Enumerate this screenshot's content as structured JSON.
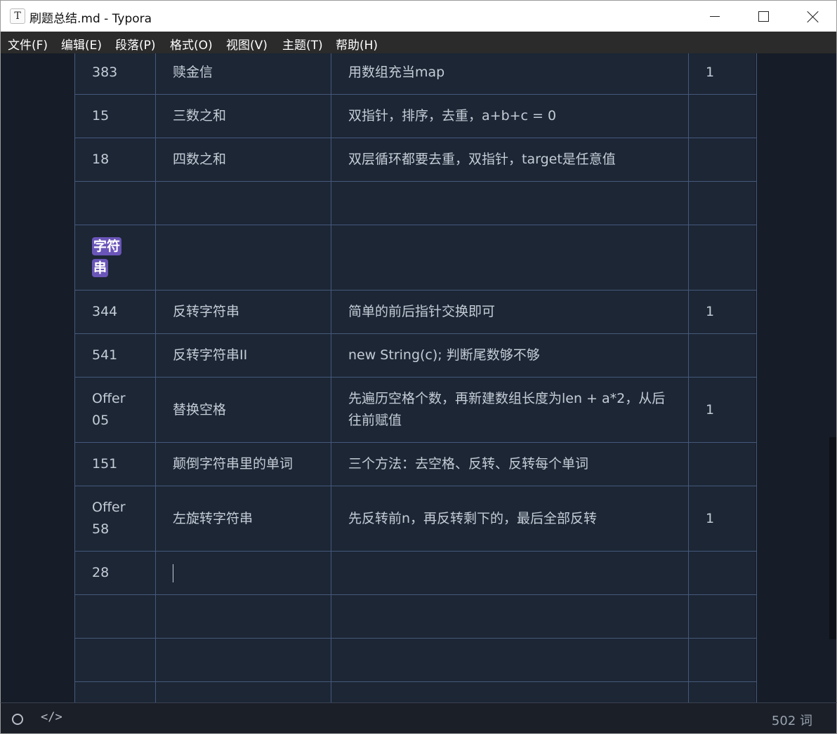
{
  "window": {
    "app_icon_letter": "T",
    "title": "刷题总结.md - Typora"
  },
  "menu": [
    "文件(F)",
    "编辑(E)",
    "段落(P)",
    "格式(O)",
    "视图(V)",
    "主题(T)",
    "帮助(H)"
  ],
  "table": {
    "rows": [
      {
        "no": "383",
        "name": "赎金信",
        "note": "用数组充当map",
        "count": "1"
      },
      {
        "no": "15",
        "name": "三数之和",
        "note": "双指针，排序，去重，a+b+c = 0",
        "count": ""
      },
      {
        "no": "18",
        "name": "四数之和",
        "note": "双层循环都要去重，双指针，target是任意值",
        "count": ""
      },
      {
        "no": "",
        "name": "",
        "note": "",
        "count": ""
      },
      {
        "section": "字符串"
      },
      {
        "no": "344",
        "name": "反转字符串",
        "note": "简单的前后指针交换即可",
        "count": "1"
      },
      {
        "no": "541",
        "name": "反转字符串II",
        "note": "new String(c); 判断尾数够不够",
        "count": ""
      },
      {
        "no": "Offer 05",
        "name": "替换空格",
        "note": "先遍历空格个数，再新建数组长度为len + a*2，从后往前赋值",
        "count": "1"
      },
      {
        "no": "151",
        "name": "颠倒字符串里的单词",
        "note": "三个方法：去空格、反转、反转每个单词",
        "count": ""
      },
      {
        "no": "Offer 58",
        "name": "左旋转字符串",
        "note": "先反转前n，再反转剩下的，最后全部反转",
        "count": "1"
      },
      {
        "no": "28",
        "name": "",
        "note": "",
        "count": "",
        "caret": true
      },
      {
        "no": "",
        "name": "",
        "note": "",
        "count": ""
      },
      {
        "no": "",
        "name": "",
        "note": "",
        "count": ""
      },
      {
        "no": "",
        "name": "",
        "note": "",
        "count": ""
      }
    ]
  },
  "status": {
    "outline_icon": "circle-icon",
    "source_icon": "code-icon",
    "source_glyph": "</>",
    "word_count": "502 词"
  }
}
